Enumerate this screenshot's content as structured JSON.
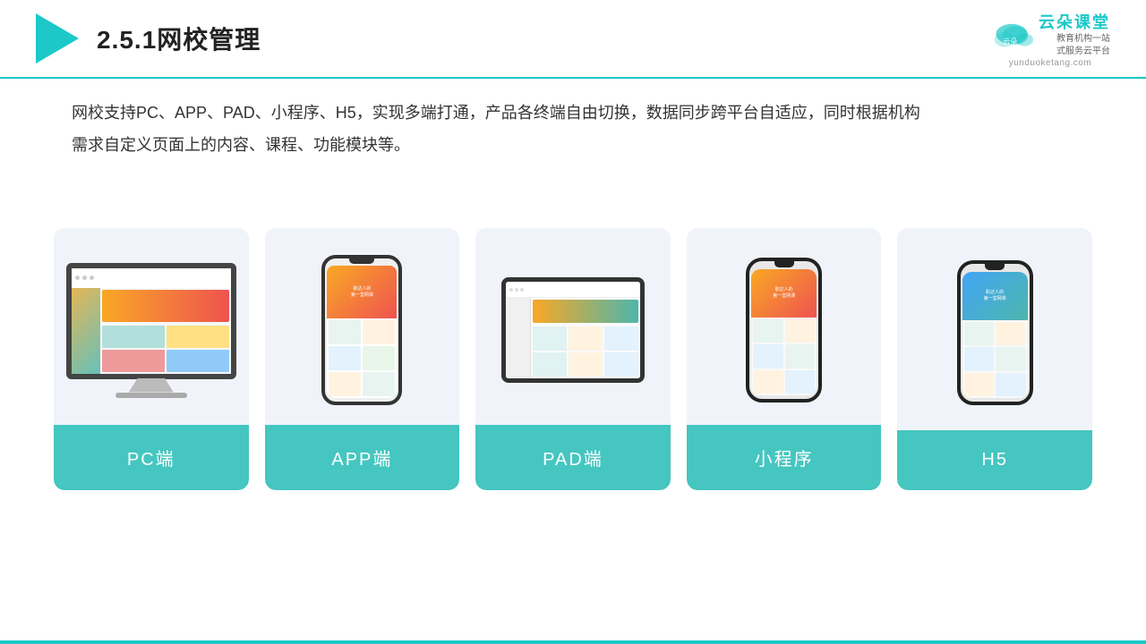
{
  "header": {
    "title": "2.5.1网校管理",
    "brand_name": "云朵课堂",
    "brand_url": "yunduoketang.com",
    "brand_tagline": "教育机构一站\n式服务云平台"
  },
  "description": {
    "text": "网校支持PC、APP、PAD、小程序、H5，实现多端打通，产品各终端自由切换，数据同步跨平台自适应，同时根据机构需求自定义页面上的内容、课程、功能模块等。"
  },
  "cards": [
    {
      "label": "PC端",
      "type": "pc"
    },
    {
      "label": "APP端",
      "type": "app"
    },
    {
      "label": "PAD端",
      "type": "pad"
    },
    {
      "label": "小程序",
      "type": "mini"
    },
    {
      "label": "H5",
      "type": "h5"
    }
  ],
  "colors": {
    "teal": "#45c6c0",
    "header_border": "#1cc8c8"
  }
}
